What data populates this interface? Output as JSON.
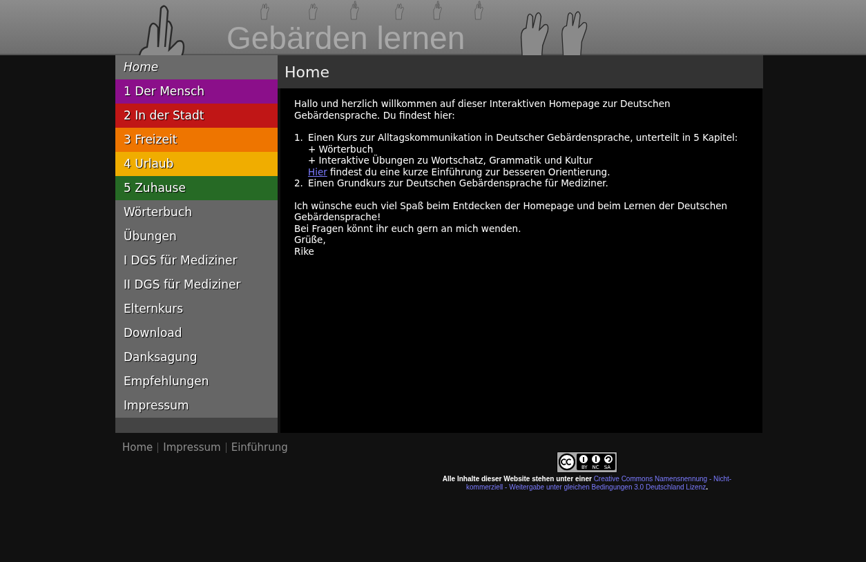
{
  "header": {
    "title": "Gebärden lernen"
  },
  "menu": [
    {
      "label": "Home",
      "selected": true
    },
    {
      "label": "1 Der Mensch",
      "selected": false,
      "color": "#8b0f8a"
    },
    {
      "label": "2 In der Stadt",
      "selected": false,
      "color": "#c01616"
    },
    {
      "label": "3 Freizeit",
      "selected": false,
      "color": "#ee7500"
    },
    {
      "label": "4 Urlaub",
      "selected": false,
      "color": "#f0ad00"
    },
    {
      "label": "5 Zuhause",
      "selected": false,
      "color": "#266a25"
    },
    {
      "label": "Wörterbuch",
      "selected": false
    },
    {
      "label": "Übungen",
      "selected": false
    },
    {
      "label": "I DGS für Mediziner",
      "selected": false
    },
    {
      "label": "II DGS für Mediziner",
      "selected": false
    },
    {
      "label": "Elternkurs",
      "selected": false
    },
    {
      "label": "Download",
      "selected": false
    },
    {
      "label": "Danksagung",
      "selected": false
    },
    {
      "label": "Empfehlungen",
      "selected": false
    },
    {
      "label": "Impressum",
      "selected": false
    }
  ],
  "page": {
    "title": "Home",
    "intro": "Hallo und herzlich willkommen auf dieser Interaktiven Homepage zur Deutschen Gebärdensprache. Du findest hier:",
    "list": [
      {
        "number": "1.",
        "text": "Einen Kurs zur Alltagskommunikation in Deutscher Gebärdensprache, unterteilt in 5 Kapitel:",
        "lines": [
          "+ Wörterbuch",
          "+ Interaktive Übungen zu Wortschatz, Grammatik und Kultur"
        ],
        "link": "Hier",
        "link_rest": " findest du eine kurze Einführung zur besseren Orientierung."
      },
      {
        "number": "2.",
        "text": "Einen Grundkurs zur Deutschen Gebärdensprache für Mediziner."
      }
    ],
    "closing": [
      "Ich wünsche euch viel Spaß beim Entdecken der Homepage und beim Lernen der Deutschen Gebärdensprache!",
      "Bei Fragen könnt ihr euch gern an mich wenden.",
      "Grüße,",
      "Rike"
    ]
  },
  "footer": {
    "links": [
      "Home",
      "Impressum",
      "Einführung"
    ],
    "license_badge": [
      "BY",
      "NC",
      "SA"
    ],
    "license_text": "Alle Inhalte dieser Website stehen unter einer ",
    "license_link": [
      "Creative Commons Namensnennung - Nicht-",
      "kommerziell - Weitergabe unter gleichen Bedingungen 3.0 Deutschland Lizenz"
    ],
    "license_end": "."
  }
}
